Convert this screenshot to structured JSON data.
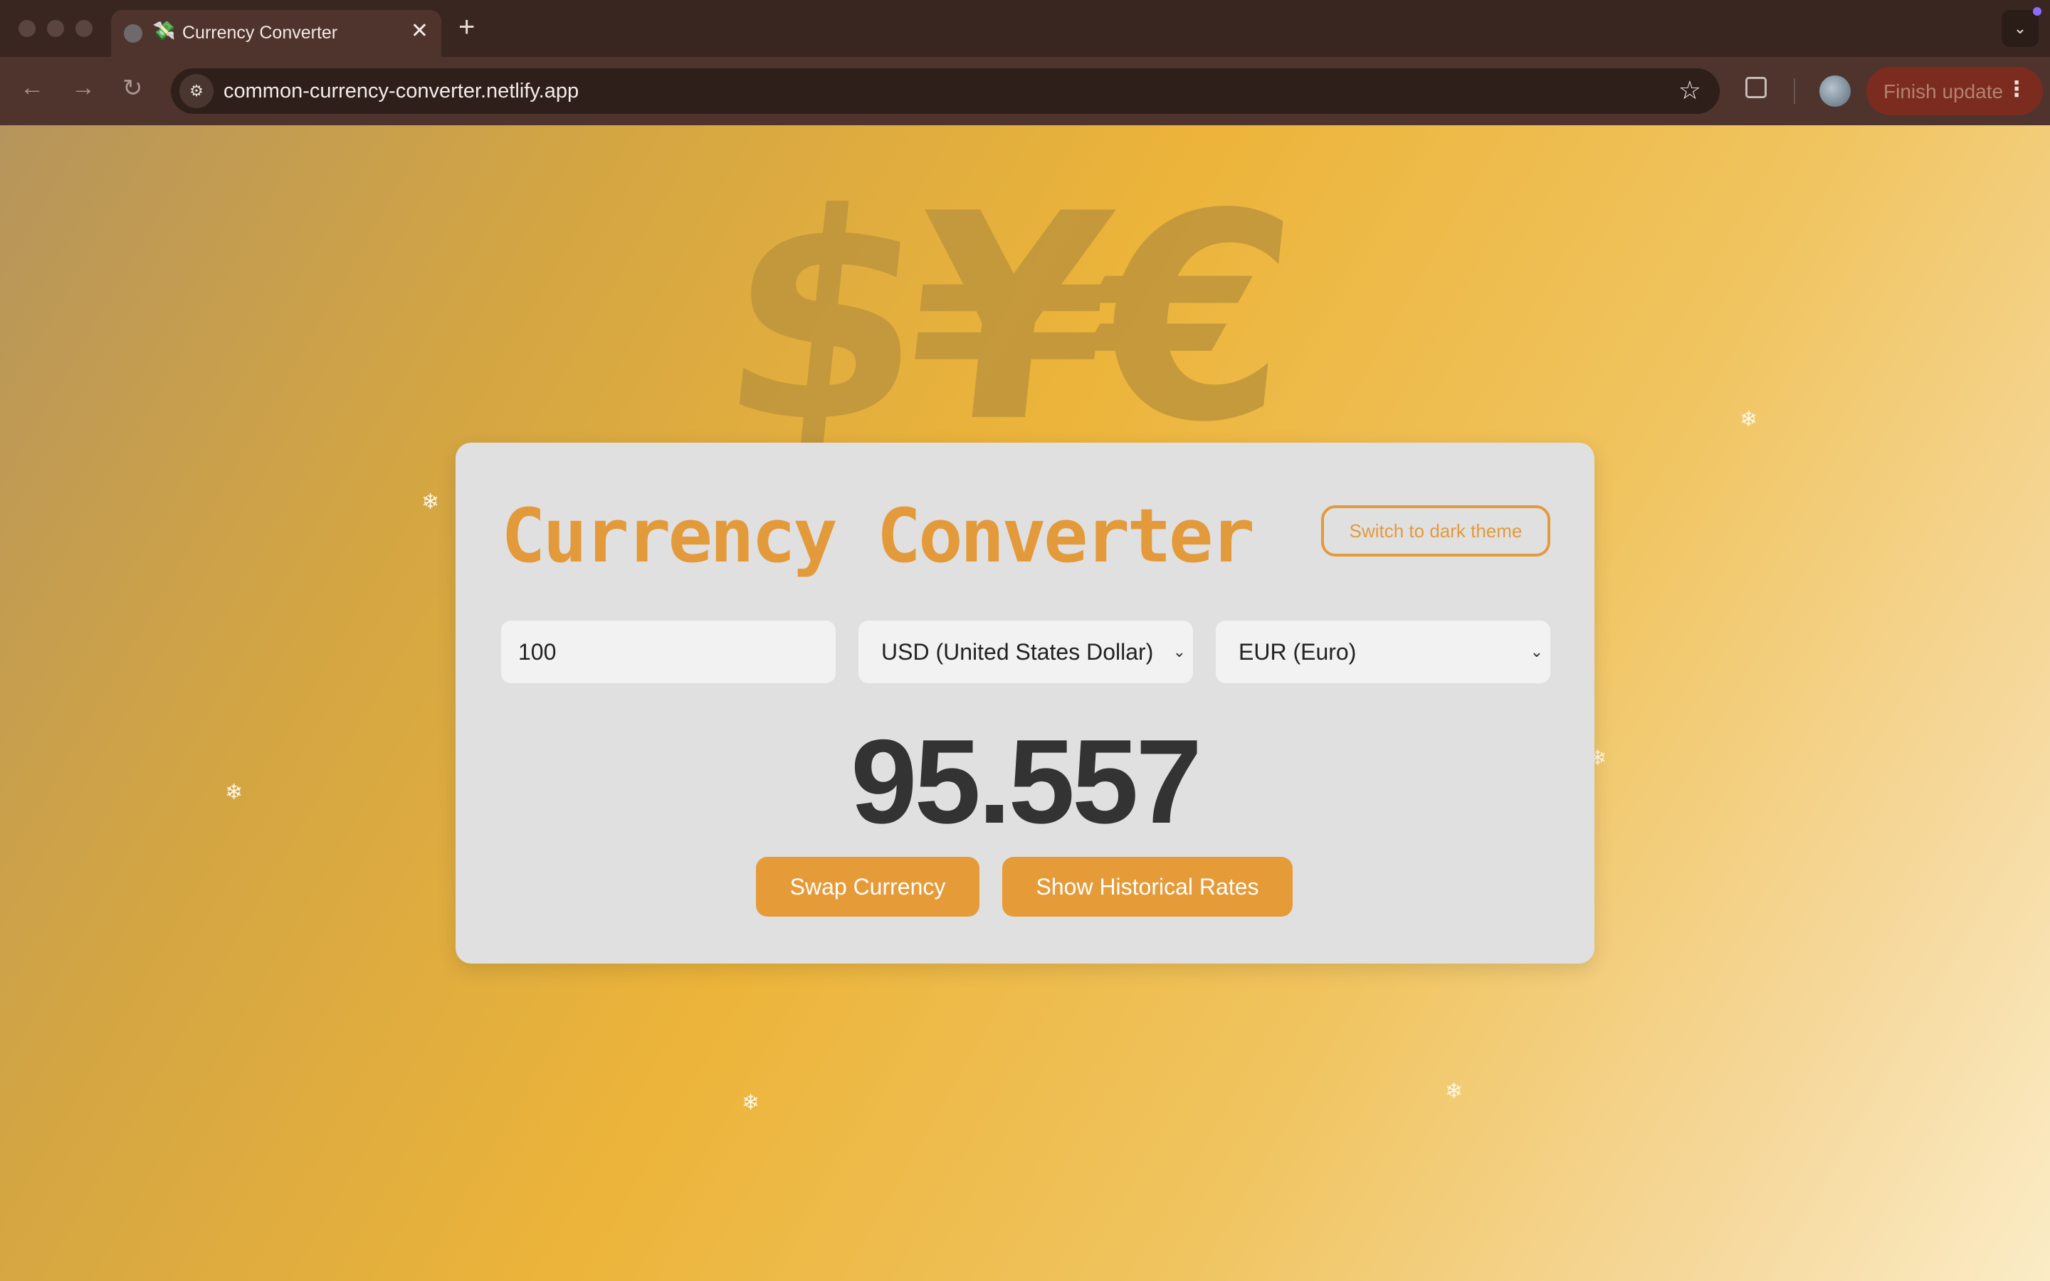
{
  "browser": {
    "tab_title": "Currency Converter",
    "tab_emoji": "💸",
    "close_glyph": "✕",
    "new_tab_glyph": "+",
    "dropdown_glyph": "⌄",
    "url": "common-currency-converter.netlify.app",
    "back_glyph": "←",
    "forward_glyph": "→",
    "reload_glyph": "↻",
    "site_info_glyph": "⚙",
    "bookmark_glyph": "☆",
    "update_button_label": "Finish update",
    "menu_glyph": "⋮"
  },
  "page": {
    "background_symbols": "$¥€£",
    "title": "Currency Converter",
    "theme_toggle_label": "Switch to dark theme",
    "amount_value": "100",
    "from_currency": "USD (United States Dollar)",
    "to_currency": "EUR (Euro)",
    "select_caret": "⌄",
    "result": "95.557",
    "swap_button_label": "Swap Currency",
    "history_button_label": "Show Historical Rates",
    "sparkle_glyph": "❄"
  },
  "colors": {
    "accent": "#e39a3b",
    "button": "#e69b39",
    "card": "#e0e0e0",
    "result_text": "#333333"
  }
}
